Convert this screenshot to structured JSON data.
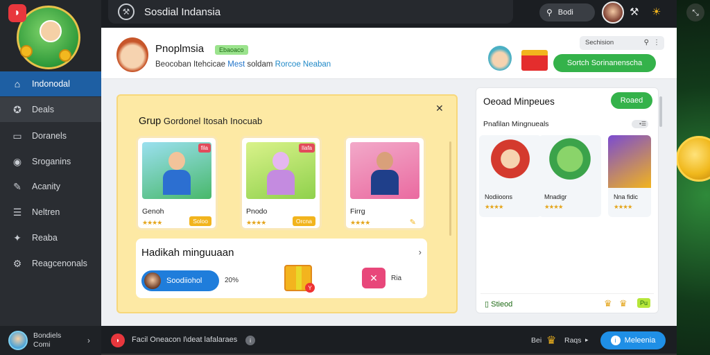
{
  "app": {
    "title": "Sosdial Indansia",
    "logo_glyph": "◗"
  },
  "sidebar": {
    "items": [
      {
        "label": "Indonodal",
        "icon": "home-icon",
        "glyph": "⌂"
      },
      {
        "label": "Deals",
        "icon": "deals-icon",
        "glyph": "✪"
      },
      {
        "label": "Doranels",
        "icon": "card-icon",
        "glyph": "▭"
      },
      {
        "label": "Sroganins",
        "icon": "chat-icon",
        "glyph": "◉"
      },
      {
        "label": "Acanity",
        "icon": "activity-icon",
        "glyph": "✎"
      },
      {
        "label": "Neltren",
        "icon": "list-icon",
        "glyph": "☰"
      },
      {
        "label": "Reaba",
        "icon": "megaphone-icon",
        "glyph": "✦"
      },
      {
        "label": "Reagcenonals",
        "icon": "gear-icon",
        "glyph": "⚙"
      }
    ],
    "user": {
      "name": "Bondiels",
      "status": "Comi"
    }
  },
  "topbar": {
    "search_label": "Bodi",
    "icons": {
      "tools": "⚒",
      "trophy": "☀",
      "expand": "⤡"
    }
  },
  "profile": {
    "name": "Pnoplmsia",
    "badge": "Ebaoaco",
    "subtitle_a": "Beocoban Itehcicae",
    "subtitle_b": "Mest",
    "subtitle_c": "soldam",
    "subtitle_d": "Rorcoe Neaban",
    "search_label": "Sechision",
    "cta": "Sortch Sorinanenscha"
  },
  "group": {
    "title_big": "Grup",
    "title_rest": "Gordonel Itosah Inocuab",
    "close": "✕",
    "cards": [
      {
        "name": "Genoh",
        "tag": "fila",
        "chip": "Soloo",
        "stars": "★★★★"
      },
      {
        "name": "Pnodo",
        "tag": "Ilafa",
        "chip": "Orcna",
        "stars": "★★★★"
      },
      {
        "name": "Firrg",
        "tag": "",
        "chip": "✎",
        "stars": "★★★★"
      }
    ],
    "weekly": {
      "title": "Hadikah minguuaan",
      "btn_label": "Soodiiohol",
      "pct": "20%",
      "share_label": "Ria"
    }
  },
  "games": {
    "title": "Oeoad Minpeues",
    "btn": "Roaed",
    "subtitle": "Pnafilan Mingnueals",
    "toggle": "•☰",
    "tiles": [
      {
        "name": "Nodiioons",
        "stars": "★★★★"
      },
      {
        "name": "Mnadigr",
        "stars": "★★★★"
      },
      {
        "name": "Nna fidic",
        "stars": "★★★★"
      }
    ],
    "footer_label": "Stieod",
    "footer_badge": "Pu"
  },
  "bottombar": {
    "text": "Facil Oneacon I\\deat lafalaraes",
    "label_a": "Bei",
    "label_b": "Raqs",
    "button": "Meleenia"
  }
}
